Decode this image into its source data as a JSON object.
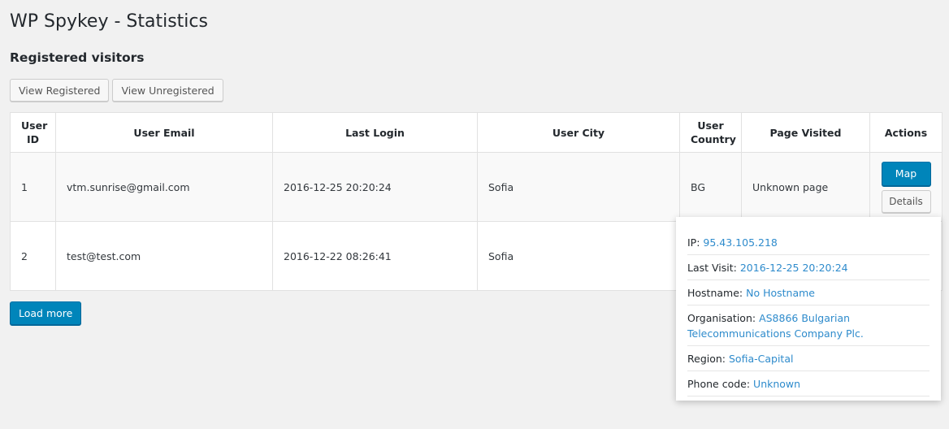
{
  "page": {
    "title": "WP Spykey - Statistics",
    "section_title": "Registered visitors"
  },
  "view_buttons": {
    "registered": "View Registered",
    "unregistered": "View Unregistered"
  },
  "table": {
    "headers": {
      "user_id_1": "User",
      "user_id_2": "ID",
      "email": "User Email",
      "last_login": "Last Login",
      "city": "User City",
      "country_1": "User",
      "country_2": "Country",
      "page": "Page Visited",
      "actions": "Actions"
    },
    "rows": [
      {
        "id": "1",
        "email": "vtm.sunrise@gmail.com",
        "last_login": "2016-12-25 20:20:24",
        "city": "Sofia",
        "country": "BG",
        "page": "Unknown page",
        "map_label": "Map",
        "details_label": "Details"
      },
      {
        "id": "2",
        "email": "test@test.com",
        "last_login": "2016-12-22 08:26:41",
        "city": "Sofia",
        "country": "",
        "page": ""
      }
    ]
  },
  "load_more": "Load more",
  "details_popup": {
    "ip_label": "IP:",
    "ip_value": "95.43.105.218",
    "last_visit_label": "Last Visit:",
    "last_visit_value": "2016-12-25 20:20:24",
    "hostname_label": "Hostname:",
    "hostname_value": "No Hostname",
    "organisation_label": "Organisation:",
    "organisation_value": "AS8866 Bulgarian Telecommunications Company Plc.",
    "region_label": "Region:",
    "region_value": "Sofia-Capital",
    "phone_code_label": "Phone code:",
    "phone_code_value": "Unknown"
  },
  "colors": {
    "primary": "#0085ba",
    "link": "#2e8bcc",
    "background": "#f1f1f1"
  }
}
